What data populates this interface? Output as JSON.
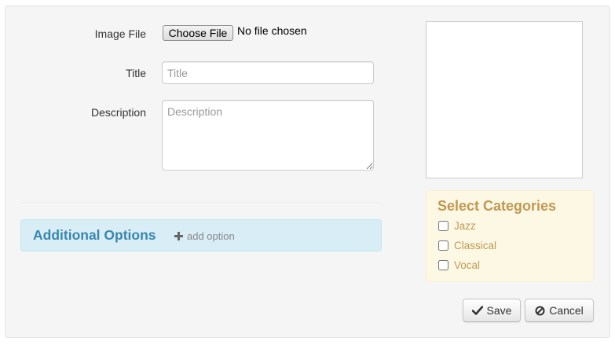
{
  "form": {
    "image_file_label": "Image File",
    "choose_file_button": "Choose File",
    "file_status": "No file chosen",
    "title_label": "Title",
    "title_placeholder": "Title",
    "title_value": "",
    "description_label": "Description",
    "description_placeholder": "Description",
    "description_value": ""
  },
  "additional_options": {
    "title": "Additional Options",
    "add_option_label": "add option",
    "add_icon": "plus-icon"
  },
  "categories": {
    "title": "Select Categories",
    "items": [
      {
        "label": "Jazz",
        "checked": false
      },
      {
        "label": "Classical",
        "checked": false
      },
      {
        "label": "Vocal",
        "checked": false
      }
    ]
  },
  "actions": {
    "save_label": "Save",
    "save_icon": "check-icon",
    "cancel_label": "Cancel",
    "cancel_icon": "ban-icon"
  },
  "colors": {
    "info_bg": "#d9edf7",
    "info_text": "#3a87ad",
    "warning_bg": "#fcf8e3",
    "warning_text": "#c09853"
  }
}
